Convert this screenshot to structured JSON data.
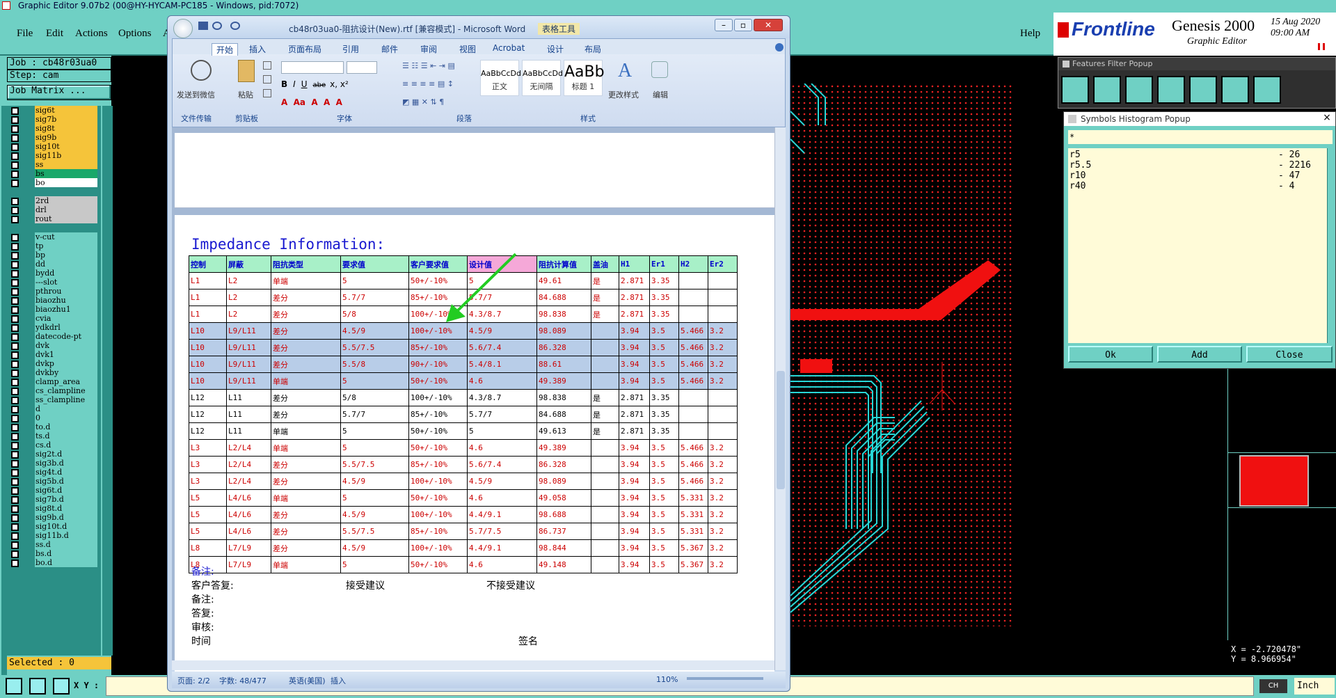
{
  "genesis": {
    "title": "Graphic Editor 9.07b2 (00@HY-HYCAM-PC185 - Windows, pid:7072)",
    "menu": [
      "File",
      "Edit",
      "Actions",
      "Options",
      "A"
    ],
    "help": "Help",
    "logo_brand": "Frontline",
    "logo_product": "Genesis 2000",
    "logo_sub": "Graphic Editor",
    "date": "15 Aug 2020",
    "time": "09:00 AM",
    "job": "Job : cb48r03ua0",
    "step": "Step: cam",
    "job_matrix": "Job Matrix ...",
    "selected": "Selected : 0",
    "xy_label": "X Y :",
    "coord_x": "X = -2.720478\"",
    "coord_y": "Y = 8.966954\"",
    "units": "Inch",
    "ime": "CH",
    "layers": [
      {
        "name": "sig6t",
        "color": "#f5c43a"
      },
      {
        "name": "sig7b",
        "color": "#f5c43a"
      },
      {
        "name": "sig8t",
        "color": "#f5c43a"
      },
      {
        "name": "sig9b",
        "color": "#f5c43a"
      },
      {
        "name": "sig10t",
        "color": "#f5c43a"
      },
      {
        "name": "sig11b",
        "color": "#f5c43a"
      },
      {
        "name": "ss",
        "color": "#f5c43a"
      },
      {
        "name": "bs",
        "color": "#1aa86a"
      },
      {
        "name": "bo",
        "color": "#ffffff"
      },
      {
        "name": "",
        "color": ""
      },
      {
        "name": "2rd",
        "color": "#c8c8c8"
      },
      {
        "name": "drl",
        "color": "#c8c8c8"
      },
      {
        "name": "rout",
        "color": "#c8c8c8"
      },
      {
        "name": "",
        "color": ""
      },
      {
        "name": "v-cut",
        "color": "#6fd0c4"
      },
      {
        "name": "tp",
        "color": "#6fd0c4"
      },
      {
        "name": "bp",
        "color": "#6fd0c4"
      },
      {
        "name": "dd",
        "color": "#6fd0c4"
      },
      {
        "name": "bydd",
        "color": "#6fd0c4"
      },
      {
        "name": "---slot",
        "color": "#6fd0c4"
      },
      {
        "name": "pthrou",
        "color": "#6fd0c4"
      },
      {
        "name": "biaozhu",
        "color": "#6fd0c4"
      },
      {
        "name": "biaozhu1",
        "color": "#6fd0c4"
      },
      {
        "name": "cvia",
        "color": "#6fd0c4"
      },
      {
        "name": "ydkdrl",
        "color": "#6fd0c4"
      },
      {
        "name": "datecode-pt",
        "color": "#6fd0c4"
      },
      {
        "name": "dvk",
        "color": "#6fd0c4"
      },
      {
        "name": "dvk1",
        "color": "#6fd0c4"
      },
      {
        "name": "dvkp",
        "color": "#6fd0c4"
      },
      {
        "name": "dvkby",
        "color": "#6fd0c4"
      },
      {
        "name": "clamp_area",
        "color": "#6fd0c4"
      },
      {
        "name": "cs_clampline",
        "color": "#6fd0c4"
      },
      {
        "name": "ss_clampline",
        "color": "#6fd0c4"
      },
      {
        "name": "d",
        "color": "#6fd0c4"
      },
      {
        "name": "0",
        "color": "#6fd0c4"
      },
      {
        "name": "to.d",
        "color": "#6fd0c4"
      },
      {
        "name": "ts.d",
        "color": "#6fd0c4"
      },
      {
        "name": "cs.d",
        "color": "#6fd0c4"
      },
      {
        "name": "sig2t.d",
        "color": "#6fd0c4"
      },
      {
        "name": "sig3b.d",
        "color": "#6fd0c4"
      },
      {
        "name": "sig4t.d",
        "color": "#6fd0c4"
      },
      {
        "name": "sig5b.d",
        "color": "#6fd0c4"
      },
      {
        "name": "sig6t.d",
        "color": "#6fd0c4"
      },
      {
        "name": "sig7b.d",
        "color": "#6fd0c4"
      },
      {
        "name": "sig8t.d",
        "color": "#6fd0c4"
      },
      {
        "name": "sig9b.d",
        "color": "#6fd0c4"
      },
      {
        "name": "sig10t.d",
        "color": "#6fd0c4"
      },
      {
        "name": "sig11b.d",
        "color": "#6fd0c4"
      },
      {
        "name": "ss.d",
        "color": "#6fd0c4"
      },
      {
        "name": "bs.d",
        "color": "#6fd0c4"
      },
      {
        "name": "bo.d",
        "color": "#6fd0c4"
      }
    ]
  },
  "features_filter": {
    "title": "Features Filter Popup"
  },
  "symbols_histogram": {
    "title": "Symbols Histogram Popup",
    "filter": "*",
    "rows": [
      [
        "r5",
        "- 26"
      ],
      [
        "r5.5",
        "- 2216"
      ],
      [
        "r10",
        "- 47"
      ],
      [
        "r40",
        "- 4"
      ]
    ],
    "ok": "Ok",
    "add": "Add",
    "close": "Close"
  },
  "word": {
    "title": "cb48r03ua0-阻抗设计(New).rtf [兼容模式] - Microsoft Word",
    "context_tab": "表格工具",
    "tabs": [
      "开始",
      "插入",
      "页面布局",
      "引用",
      "邮件",
      "审阅",
      "视图",
      "Acrobat",
      "设计",
      "布局"
    ],
    "groups": [
      "文件传输",
      "剪贴板",
      "字体",
      "段落",
      "样式",
      "编辑"
    ],
    "send_wechat": "发送到微信",
    "paste": "粘贴",
    "styles": [
      {
        "preview": "AaBbCcDd",
        "name": "正文"
      },
      {
        "preview": "AaBbCcDd",
        "name": "无间隔"
      },
      {
        "preview": "AaBb",
        "name": "标题 1"
      }
    ],
    "change_styles": "更改样式",
    "edit": "编辑",
    "heading": "Impedance Information:",
    "columns": [
      "控制",
      "屏蔽",
      "阻抗类型",
      "要求值",
      "客户要求值",
      "设计值",
      "阻抗计算值",
      "盖油",
      "H1",
      "Er1",
      "H2",
      "Er2"
    ],
    "rows": [
      {
        "cells": [
          "L1",
          "L2",
          "单端",
          "5",
          "50+/-10%",
          "5",
          "49.61",
          "是",
          "2.871",
          "3.35",
          "",
          ""
        ],
        "style": "red"
      },
      {
        "cells": [
          "L1",
          "L2",
          "差分",
          "5.7/7",
          "85+/-10%",
          "5.7/7",
          "84.688",
          "是",
          "2.871",
          "3.35",
          "",
          ""
        ],
        "style": "red"
      },
      {
        "cells": [
          "L1",
          "L2",
          "差分",
          "5/8",
          "100+/-10%",
          "4.3/8.7",
          "98.838",
          "是",
          "2.871",
          "3.35",
          "",
          ""
        ],
        "style": "red"
      },
      {
        "cells": [
          "L10",
          "L9/L11",
          "差分",
          "4.5/9",
          "100+/-10%",
          "4.5/9",
          "98.089",
          "",
          "3.94",
          "3.5",
          "5.466",
          "3.2"
        ],
        "style": "redhl"
      },
      {
        "cells": [
          "L10",
          "L9/L11",
          "差分",
          "5.5/7.5",
          "85+/-10%",
          "5.6/7.4",
          "86.328",
          "",
          "3.94",
          "3.5",
          "5.466",
          "3.2"
        ],
        "style": "redhl"
      },
      {
        "cells": [
          "L10",
          "L9/L11",
          "差分",
          "5.5/8",
          "90+/-10%",
          "5.4/8.1",
          "88.61",
          "",
          "3.94",
          "3.5",
          "5.466",
          "3.2"
        ],
        "style": "redhl"
      },
      {
        "cells": [
          "L10",
          "L9/L11",
          "单端",
          "5",
          "50+/-10%",
          "4.6",
          "49.389",
          "",
          "3.94",
          "3.5",
          "5.466",
          "3.2"
        ],
        "style": "redhl"
      },
      {
        "cells": [
          "L12",
          "L11",
          "差分",
          "5/8",
          "100+/-10%",
          "4.3/8.7",
          "98.838",
          "是",
          "2.871",
          "3.35",
          "",
          ""
        ],
        "style": "black"
      },
      {
        "cells": [
          "L12",
          "L11",
          "差分",
          "5.7/7",
          "85+/-10%",
          "5.7/7",
          "84.688",
          "是",
          "2.871",
          "3.35",
          "",
          ""
        ],
        "style": "black"
      },
      {
        "cells": [
          "L12",
          "L11",
          "单端",
          "5",
          "50+/-10%",
          "5",
          "49.613",
          "是",
          "2.871",
          "3.35",
          "",
          ""
        ],
        "style": "black"
      },
      {
        "cells": [
          "L3",
          "L2/L4",
          "单端",
          "5",
          "50+/-10%",
          "4.6",
          "49.389",
          "",
          "3.94",
          "3.5",
          "5.466",
          "3.2"
        ],
        "style": "red"
      },
      {
        "cells": [
          "L3",
          "L2/L4",
          "差分",
          "5.5/7.5",
          "85+/-10%",
          "5.6/7.4",
          "86.328",
          "",
          "3.94",
          "3.5",
          "5.466",
          "3.2"
        ],
        "style": "red"
      },
      {
        "cells": [
          "L3",
          "L2/L4",
          "差分",
          "4.5/9",
          "100+/-10%",
          "4.5/9",
          "98.089",
          "",
          "3.94",
          "3.5",
          "5.466",
          "3.2"
        ],
        "style": "red"
      },
      {
        "cells": [
          "L5",
          "L4/L6",
          "单端",
          "5",
          "50+/-10%",
          "4.6",
          "49.058",
          "",
          "3.94",
          "3.5",
          "5.331",
          "3.2"
        ],
        "style": "red"
      },
      {
        "cells": [
          "L5",
          "L4/L6",
          "差分",
          "4.5/9",
          "100+/-10%",
          "4.4/9.1",
          "98.688",
          "",
          "3.94",
          "3.5",
          "5.331",
          "3.2"
        ],
        "style": "red"
      },
      {
        "cells": [
          "L5",
          "L4/L6",
          "差分",
          "5.5/7.5",
          "85+/-10%",
          "5.7/7.5",
          "86.737",
          "",
          "3.94",
          "3.5",
          "5.331",
          "3.2"
        ],
        "style": "red"
      },
      {
        "cells": [
          "L8",
          "L7/L9",
          "差分",
          "4.5/9",
          "100+/-10%",
          "4.4/9.1",
          "98.844",
          "",
          "3.94",
          "3.5",
          "5.367",
          "3.2"
        ],
        "style": "red"
      },
      {
        "cells": [
          "L8",
          "L7/L9",
          "单端",
          "5",
          "50+/-10%",
          "4.6",
          "49.148",
          "",
          "3.94",
          "3.5",
          "5.367",
          "3.2"
        ],
        "style": "red"
      }
    ],
    "note1": "备注:",
    "reply": "客户答复:",
    "accept": "接受建议",
    "reject": "不接受建议",
    "note2": "备注:",
    "answer": "答复:",
    "review": "审核:",
    "time": "时间",
    "sign": "签名",
    "status_page": "页面: 2/2",
    "status_words": "字数: 48/477",
    "status_lang": "英语(美国)",
    "status_insert": "插入",
    "zoom": "110%"
  }
}
